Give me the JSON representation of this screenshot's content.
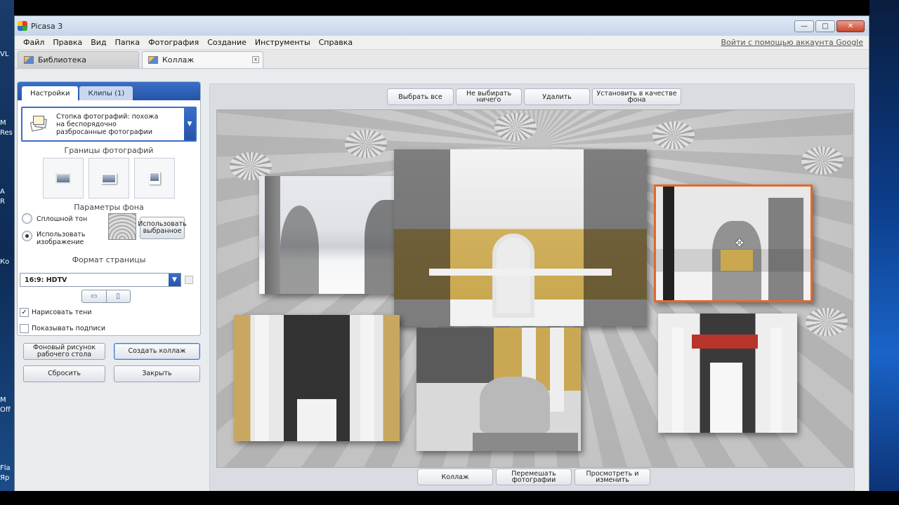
{
  "window": {
    "title": "Picasa 3",
    "controls": {
      "minimize": "—",
      "maximize": "□",
      "close": "✕"
    }
  },
  "menu": {
    "items": [
      "Файл",
      "Правка",
      "Вид",
      "Папка",
      "Фотография",
      "Создание",
      "Инструменты",
      "Справка"
    ],
    "signin": "Войти с помощью аккаунта Google"
  },
  "doc_tabs": {
    "library": "Библиотека",
    "collage": "Коллаж",
    "close_glyph": "x"
  },
  "left_panel": {
    "tabs": {
      "settings": "Настройки",
      "clips": "Клипы (1)"
    },
    "collage_type": "Стопка фотографий: похожа на беспорядочно разбросанные фотографии",
    "borders_label": "Границы фотографий",
    "bg_label": "Параметры фона",
    "solid_color": "Сплошной тон",
    "use_image": "Использовать изображение",
    "use_selected": "Использовать выбранное",
    "page_format_label": "Формат страницы",
    "page_format_value": "16:9: HDTV",
    "draw_shadows": "Нарисовать тени",
    "show_captions": "Показывать подписи",
    "draw_shadows_checked": true,
    "show_captions_checked": false,
    "desktop_bg_btn": "Фоновый рисунок рабочего стола",
    "create_collage_btn": "Создать коллаж",
    "reset_btn": "Сбросить",
    "close_btn": "Закрыть"
  },
  "workspace": {
    "top_buttons": {
      "select_all": "Выбрать все",
      "select_none": "Не выбирать ничего",
      "delete": "Удалить",
      "set_as_bg": "Установить в качестве фона"
    },
    "bottom_buttons": {
      "collage": "Коллаж",
      "shuffle": "Перемешать фотографии",
      "view_edit": "Просмотреть и изменить"
    }
  },
  "desktop": {
    "left_labels": [
      "VL",
      "M",
      "Res",
      "A",
      "R",
      "Ко",
      "M",
      "Off",
      "Fla",
      "Яр"
    ]
  },
  "colors": {
    "accent_blue": "#2f63b8",
    "selection_orange": "#e2692a"
  },
  "icons": {
    "app": "picasa-icon",
    "cursor": "move-cursor-icon"
  }
}
